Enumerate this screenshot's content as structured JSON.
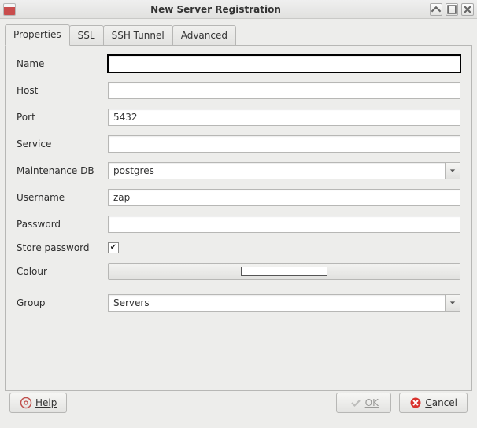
{
  "window": {
    "title": "New Server Registration"
  },
  "tabs": {
    "properties": "Properties",
    "ssl": "SSL",
    "ssh_tunnel": "SSH Tunnel",
    "advanced": "Advanced"
  },
  "form": {
    "name": {
      "label": "Name",
      "value": ""
    },
    "host": {
      "label": "Host",
      "value": ""
    },
    "port": {
      "label": "Port",
      "value": "5432"
    },
    "service": {
      "label": "Service",
      "value": ""
    },
    "maintenance_db": {
      "label": "Maintenance DB",
      "value": "postgres"
    },
    "username": {
      "label": "Username",
      "value": "zap"
    },
    "password": {
      "label": "Password",
      "value": ""
    },
    "store_password": {
      "label": "Store password",
      "checked": true
    },
    "colour": {
      "label": "Colour",
      "value": "#ffffff"
    },
    "group": {
      "label": "Group",
      "value": "Servers"
    }
  },
  "buttons": {
    "help": "Help",
    "ok": "OK",
    "cancel": "Cancel"
  }
}
